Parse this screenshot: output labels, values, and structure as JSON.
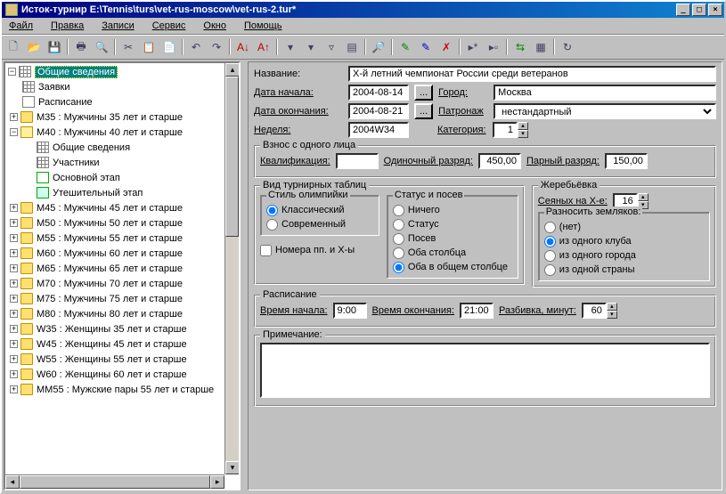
{
  "title": "Исток-турнир E:\\Tennis\\turs\\vet-rus-moscow\\vet-rus-2.tur*",
  "menu": {
    "file": "Файл",
    "edit": "Правка",
    "records": "Записи",
    "service": "Сервис",
    "window": "Окно",
    "help": "Помощь"
  },
  "tree": {
    "root": "Общие сведения",
    "applications": "Заявки",
    "schedule": "Расписание",
    "m35": "M35 : Мужчины 35 лет и старше",
    "m40": "M40 : Мужчины 40 лет и старше",
    "m40_general": "Общие сведения",
    "m40_participants": "Участники",
    "m40_main": "Основной этап",
    "m40_consolation": "Утешительный этап",
    "m45": "M45 : Мужчины 45 лет и старше",
    "m50": "M50 : Мужчины 50 лет и старше",
    "m55": "M55 : Мужчины 55 лет и старше",
    "m60": "M60 : Мужчины 60 лет и старше",
    "m65": "M65 : Мужчины 65 лет и старше",
    "m70": "M70 : Мужчины 70 лет и старше",
    "m75": "M75 : Мужчины 75 лет и старше",
    "m80": "M80 : Мужчины 80 лет и старше",
    "w35": "W35 : Женщины 35 лет и старше",
    "w45": "W45 : Женщины 45 лет и старше",
    "w55": "W55 : Женщины 55 лет и старше",
    "w60": "W60 : Женщины 60 лет и старше",
    "mm55": "MM55 : Мужские пары 55 лет и старше"
  },
  "form": {
    "name_label": "Название:",
    "name_value": "X-й летний чемпионат России среди ветеранов",
    "start_label": "Дата начала:",
    "start_value": "2004-08-14",
    "end_label": "Дата окончания:",
    "end_value": "2004-08-21",
    "week_label": "Неделя:",
    "week_value": "2004W34",
    "btn_ellipsis": "...",
    "city_label": "Город:",
    "city_value": "Москва",
    "patronage_label": "Патронаж",
    "patronage_value": "нестандартный",
    "category_label": "Категория:",
    "category_value": "1"
  },
  "fee": {
    "legend": "Взнос с одного лица",
    "qual_label": "Квалификация:",
    "qual_value": "",
    "singles_label": "Одиночный разряд:",
    "singles_value": "450,00",
    "doubles_label": "Парный разряд:",
    "doubles_value": "150,00"
  },
  "draws": {
    "legend": "Вид турнирных таблиц",
    "olympic_legend": "Стиль олимпийки",
    "olympic_classic": "Классический",
    "olympic_modern": "Современный",
    "numbers_check": "Номера пп. и X-ы",
    "status_legend": "Статус и посев",
    "status_none": "Ничего",
    "status_status": "Статус",
    "status_seed": "Посев",
    "status_both_cols": "Оба столбца",
    "status_both_one": "Оба в общем столбце"
  },
  "seeding": {
    "legend": "Жеребьёвка",
    "seeded_label": "Сеяных на X-е:",
    "seeded_value": "16",
    "spread_legend": "Разносить земляков:",
    "spread_none": "(нет)",
    "spread_club": "из одного клуба",
    "spread_city": "из одного города",
    "spread_country": "из одной страны"
  },
  "schedule": {
    "legend": "Расписание",
    "start_label": "Время начала:",
    "start_value": "9:00",
    "end_label": "Время окончания:",
    "end_value": "21:00",
    "break_label": "Разбивка, минут:",
    "break_value": "60"
  },
  "notes": {
    "legend": "Примечание:",
    "value": ""
  },
  "winbuttons": {
    "min": "_",
    "max": "□",
    "close": "×"
  }
}
